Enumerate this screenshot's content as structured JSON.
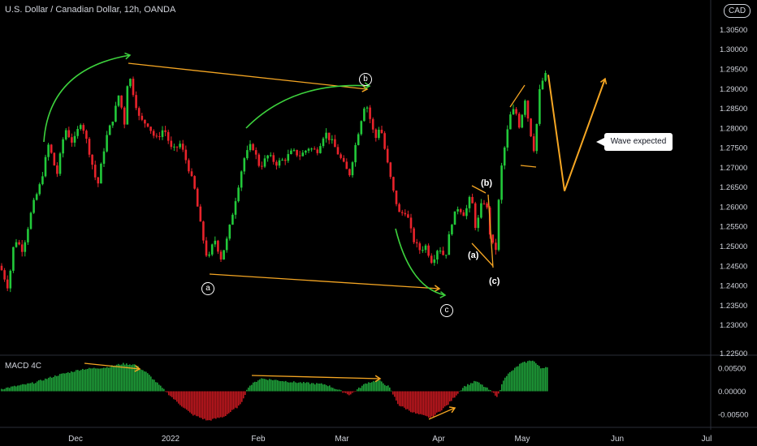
{
  "header": {
    "title": "U.S. Dollar / Canadian Dollar, 12h, OANDA",
    "currency": "CAD"
  },
  "indicator": {
    "title": "MACD 4C"
  },
  "annotations": {
    "note": "Wave expected",
    "labels": [
      "a",
      "b",
      "c",
      "(a)",
      "(b)",
      "(c)"
    ]
  },
  "colors": {
    "bull": "#22c93a",
    "bear": "#e8232b",
    "green_arrow": "#3dd23d",
    "orange_line": "#f5a623",
    "macd_green": "#1fa03a",
    "macd_red": "#c2181f",
    "background": "#000000",
    "axis_text": "#d1d4dc"
  },
  "chart_data": [
    {
      "type": "candlestick",
      "title": "U.S. Dollar / Canadian Dollar, 12h, OANDA",
      "yticks": [
        "1.23000",
        "1.23500",
        "1.24000",
        "1.24500",
        "1.25000",
        "1.25500",
        "1.26000",
        "1.26500",
        "1.27000",
        "1.27500",
        "1.28000",
        "1.28500",
        "1.29000",
        "1.29500",
        "1.30000",
        "1.30500"
      ],
      "ylim": [
        1.2225,
        1.3125
      ],
      "xticks": [
        "Dec",
        "2022",
        "Feb",
        "Mar",
        "Apr",
        "May",
        "Jun",
        "Jul"
      ],
      "path_points": [
        [
          0,
          1.245
        ],
        [
          10,
          1.2395
        ],
        [
          18,
          1.252
        ],
        [
          28,
          1.249
        ],
        [
          40,
          1.26
        ],
        [
          50,
          1.266
        ],
        [
          60,
          1.276
        ],
        [
          70,
          1.268
        ],
        [
          80,
          1.28
        ],
        [
          90,
          1.276
        ],
        [
          100,
          1.282
        ],
        [
          110,
          1.274
        ],
        [
          120,
          1.265
        ],
        [
          130,
          1.277
        ],
        [
          140,
          1.283
        ],
        [
          148,
          1.29
        ],
        [
          152,
          1.278
        ],
        [
          158,
          1.2945
        ],
        [
          164,
          1.289
        ],
        [
          172,
          1.282
        ],
        [
          182,
          1.281
        ],
        [
          192,
          1.277
        ],
        [
          202,
          1.28
        ],
        [
          212,
          1.274
        ],
        [
          222,
          1.276
        ],
        [
          232,
          1.27
        ],
        [
          240,
          1.264
        ],
        [
          248,
          1.254
        ],
        [
          256,
          1.246
        ],
        [
          264,
          1.252
        ],
        [
          272,
          1.247
        ],
        [
          280,
          1.252
        ],
        [
          290,
          1.262
        ],
        [
          300,
          1.272
        ],
        [
          310,
          1.276
        ],
        [
          320,
          1.27
        ],
        [
          330,
          1.273
        ],
        [
          340,
          1.271
        ],
        [
          350,
          1.272
        ],
        [
          360,
          1.274
        ],
        [
          370,
          1.273
        ],
        [
          380,
          1.275
        ],
        [
          390,
          1.274
        ],
        [
          400,
          1.279
        ],
        [
          410,
          1.276
        ],
        [
          420,
          1.272
        ],
        [
          430,
          1.268
        ],
        [
          440,
          1.278
        ],
        [
          450,
          1.287
        ],
        [
          456,
          1.282
        ],
        [
          462,
          1.277
        ],
        [
          468,
          1.281
        ],
        [
          476,
          1.272
        ],
        [
          484,
          1.264
        ],
        [
          492,
          1.258
        ],
        [
          500,
          1.259
        ],
        [
          508,
          1.252
        ],
        [
          516,
          1.249
        ],
        [
          524,
          1.25
        ],
        [
          532,
          1.246
        ],
        [
          540,
          1.25
        ],
        [
          548,
          1.247
        ],
        [
          556,
          1.256
        ],
        [
          564,
          1.26
        ],
        [
          572,
          1.258
        ],
        [
          580,
          1.263
        ],
        [
          586,
          1.254
        ],
        [
          592,
          1.26
        ],
        [
          598,
          1.262
        ],
        [
          604,
          1.252
        ],
        [
          610,
          1.248
        ],
        [
          616,
          1.268
        ],
        [
          622,
          1.276
        ],
        [
          628,
          1.283
        ],
        [
          634,
          1.285
        ],
        [
          640,
          1.28
        ],
        [
          646,
          1.288
        ],
        [
          652,
          1.28
        ],
        [
          658,
          1.274
        ],
        [
          664,
          1.289
        ],
        [
          670,
          1.2935
        ],
        [
          674,
          1.293
        ]
      ],
      "forecast_points": [
        [
          675,
          1.2935
        ],
        [
          695,
          1.264
        ],
        [
          745,
          1.2925
        ]
      ]
    },
    {
      "type": "bar",
      "title": "MACD 4C",
      "yticks": [
        "0.00500",
        "0.00000",
        "-0.00500"
      ],
      "ylim": [
        -0.0075,
        0.0075
      ],
      "path_points": [
        [
          0,
          0.0005
        ],
        [
          40,
          0.0018
        ],
        [
          70,
          0.0035
        ],
        [
          100,
          0.0048
        ],
        [
          130,
          0.0052
        ],
        [
          150,
          0.006
        ],
        [
          165,
          0.0058
        ],
        [
          180,
          0.004
        ],
        [
          200,
          0.0005
        ],
        [
          215,
          -0.002
        ],
        [
          235,
          -0.005
        ],
        [
          255,
          -0.0064
        ],
        [
          275,
          -0.0055
        ],
        [
          295,
          -0.003
        ],
        [
          305,
          0.001
        ],
        [
          320,
          0.0028
        ],
        [
          360,
          0.002
        ],
        [
          400,
          0.0015
        ],
        [
          430,
          -0.0008
        ],
        [
          450,
          0.0018
        ],
        [
          465,
          0.0024
        ],
        [
          478,
          0.001
        ],
        [
          490,
          -0.003
        ],
        [
          510,
          -0.0048
        ],
        [
          530,
          -0.0058
        ],
        [
          550,
          -0.003
        ],
        [
          570,
          0.001
        ],
        [
          585,
          0.0022
        ],
        [
          600,
          0.0005
        ],
        [
          612,
          -0.0012
        ],
        [
          620,
          0.003
        ],
        [
          640,
          0.006
        ],
        [
          655,
          0.0068
        ],
        [
          665,
          0.005
        ],
        [
          675,
          0.0055
        ]
      ]
    }
  ]
}
